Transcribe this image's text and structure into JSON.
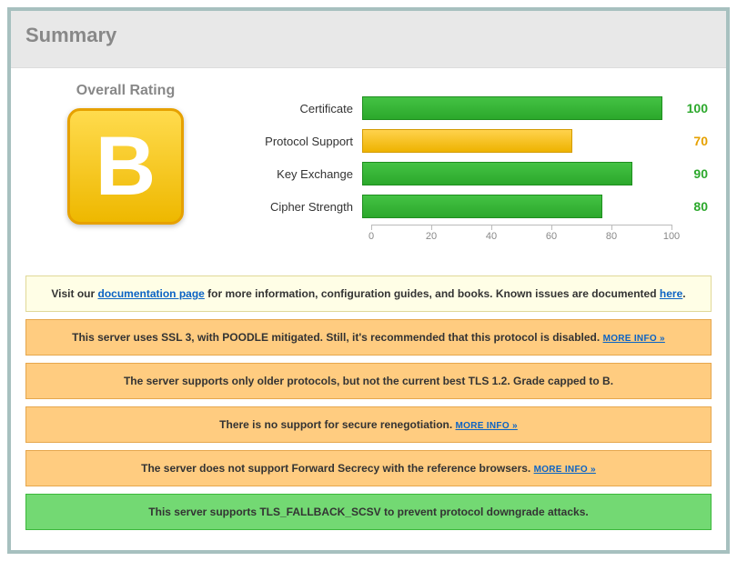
{
  "summary": {
    "title": "Summary"
  },
  "rating": {
    "label": "Overall Rating",
    "grade": "B"
  },
  "chart_data": {
    "type": "bar",
    "categories": [
      "Certificate",
      "Protocol Support",
      "Key Exchange",
      "Cipher Strength"
    ],
    "values": [
      100,
      70,
      90,
      80
    ],
    "colors": [
      "green",
      "warn",
      "green",
      "green"
    ],
    "xlabel": "",
    "ylabel": "",
    "ylim": [
      0,
      100
    ],
    "ticks": [
      0,
      20,
      40,
      60,
      80,
      100
    ]
  },
  "bars": {
    "0": {
      "label": "Certificate",
      "value": "100"
    },
    "1": {
      "label": "Protocol Support",
      "value": "70"
    },
    "2": {
      "label": "Key Exchange",
      "value": "90"
    },
    "3": {
      "label": "Cipher Strength",
      "value": "80"
    }
  },
  "axis": {
    "t0": "0",
    "t1": "20",
    "t2": "40",
    "t3": "60",
    "t4": "80",
    "t5": "100"
  },
  "notices": {
    "doc_pre": "Visit our ",
    "doc_link": "documentation page",
    "doc_mid": " for more information, configuration guides, and books. Known issues are documented ",
    "doc_here": "here",
    "doc_post": ".",
    "ssl3_text": "This server uses SSL 3, with POODLE mitigated. Still, it's recommended that this protocol is disabled. ",
    "more_info": "MORE INFO »",
    "older_protocols": "The server supports only older protocols, but not the current best TLS 1.2. Grade capped to B.",
    "reneg_text": "There is no support for secure renegotiation.  ",
    "fs_text": "The server does not support Forward Secrecy with the reference browsers.  ",
    "fallback": "This server supports TLS_FALLBACK_SCSV to prevent protocol downgrade attacks."
  }
}
